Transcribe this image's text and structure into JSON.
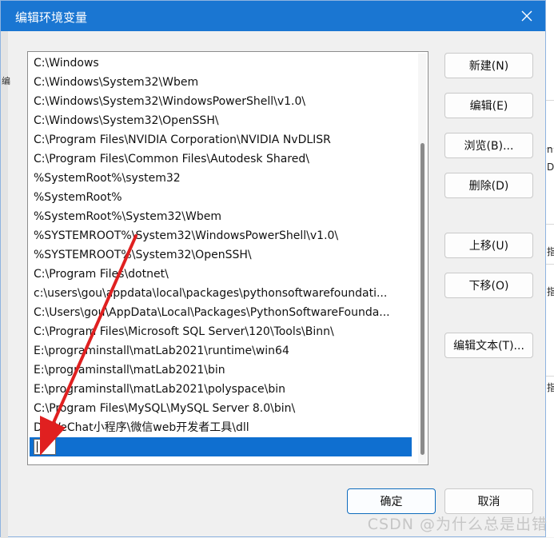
{
  "dialog": {
    "title": "编辑环境变量",
    "close_icon": "close-icon"
  },
  "paths": [
    "C:\\Windows",
    "C:\\Windows\\System32\\Wbem",
    "C:\\Windows\\System32\\WindowsPowerShell\\v1.0\\",
    "C:\\Windows\\System32\\OpenSSH\\",
    "C:\\Program Files\\NVIDIA Corporation\\NVIDIA NvDLISR",
    "C:\\Program Files\\Common Files\\Autodesk Shared\\",
    "%SystemRoot%\\system32",
    "%SystemRoot%",
    "%SystemRoot%\\System32\\Wbem",
    "%SYSTEMROOT%\\System32\\WindowsPowerShell\\v1.0\\",
    "%SYSTEMROOT%\\System32\\OpenSSH\\",
    "C:\\Program Files\\dotnet\\",
    "c:\\users\\gou\\appdata\\local\\packages\\pythonsoftwarefoundati...",
    "C:\\Users\\gou\\AppData\\Local\\Packages\\PythonSoftwareFounda...",
    "C:\\Program Files\\Microsoft SQL Server\\120\\Tools\\Binn\\",
    "E:\\programinstall\\matLab2021\\runtime\\win64",
    "E:\\programinstall\\matLab2021\\bin",
    "E:\\programinstall\\matLab2021\\polyspace\\bin",
    "C:\\Program Files\\MySQL\\MySQL Server 8.0\\bin\\",
    "D:\\WeChat小程序\\微信web开发者工具\\dll"
  ],
  "new_entry_value": "",
  "buttons": {
    "new": "新建(N)",
    "edit": "编辑(E)",
    "browse": "浏览(B)...",
    "delete": "删除(D)",
    "move_up": "上移(U)",
    "move_down": "下移(O)",
    "edit_text": "编辑文本(T)...",
    "ok": "确定",
    "cancel": "取消"
  },
  "background_fragments": [
    "编",
    "n",
    "D",
    "指",
    "指",
    "指"
  ],
  "watermark": "CSDN @为什么总是出错",
  "colors": {
    "titlebar": "#1a76d2",
    "selection": "#0f6fd0",
    "annotation_arrow": "#e02020"
  }
}
